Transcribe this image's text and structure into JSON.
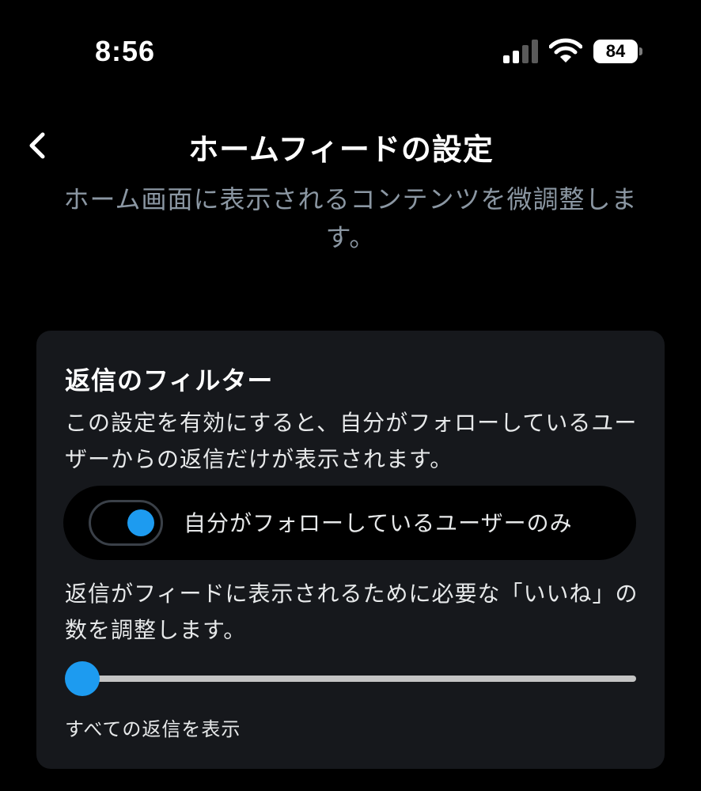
{
  "status_bar": {
    "time": "8:56",
    "battery_level": "84",
    "icons": [
      "cellular-signal-icon",
      "wifi-icon",
      "battery-icon"
    ]
  },
  "nav": {
    "back_icon": "chevron-left-icon",
    "title": "ホームフィードの設定"
  },
  "subtitle": "ホーム画面に表示されるコンテンツを微調整します。",
  "reply_filter": {
    "title": "返信のフィルター",
    "description": "この設定を有効にすると、自分がフォローしているユーザーからの返信だけが表示されます。",
    "toggle": {
      "label": "自分がフォローしているユーザーのみ",
      "enabled": true
    },
    "slider": {
      "description": "返信がフィードに表示されるために必要な「いいね」の数を調整します。",
      "value_label": "すべての返信を表示",
      "level": 0
    }
  },
  "colors": {
    "background": "#000000",
    "card": "#16181c",
    "accent": "#1d9bf0",
    "secondary_text": "#8b97a3",
    "track": "#c4c4c4"
  }
}
